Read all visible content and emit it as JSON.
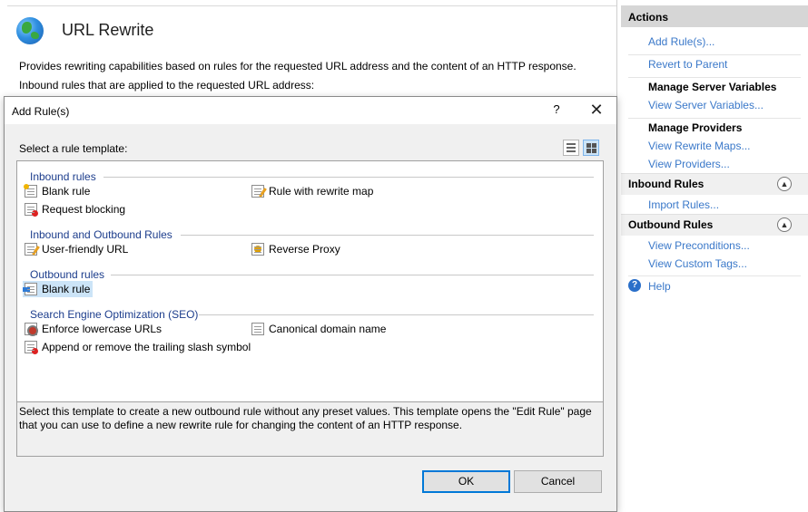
{
  "page": {
    "title": "URL Rewrite",
    "description": "Provides rewriting capabilities based on rules for the requested URL address and the content of an HTTP response.",
    "subheading": "Inbound rules that are applied to the requested URL address:"
  },
  "actions": {
    "header": "Actions",
    "add_rules": "Add Rule(s)...",
    "revert": "Revert to Parent",
    "manage_server_vars": "Manage Server Variables",
    "view_server_vars": "View Server Variables...",
    "manage_providers": "Manage Providers",
    "view_rewrite_maps": "View Rewrite Maps...",
    "view_providers": "View Providers...",
    "inbound_rules": "Inbound Rules",
    "import_rules": "Import Rules...",
    "outbound_rules": "Outbound Rules",
    "view_preconditions": "View Preconditions...",
    "view_custom_tags": "View Custom Tags...",
    "help": "Help"
  },
  "dialog": {
    "title": "Add Rule(s)",
    "help_glyph": "?",
    "close_glyph": "✕",
    "select_label": "Select a rule template:",
    "groups": {
      "inbound": "Inbound rules",
      "inout": "Inbound and Outbound Rules",
      "outbound": "Outbound rules",
      "seo": "Search Engine Optimization (SEO)"
    },
    "items": {
      "blank_rule_in": "Blank rule",
      "rule_with_map": "Rule with rewrite map",
      "request_blocking": "Request blocking",
      "user_friendly_url": "User-friendly URL",
      "reverse_proxy": "Reverse Proxy",
      "blank_rule_out": "Blank rule",
      "enforce_lowercase": "Enforce lowercase URLs",
      "canonical_domain": "Canonical domain name",
      "trailing_slash": "Append or remove the trailing slash symbol"
    },
    "selected_item": "Blank rule",
    "description": "Select this template to create a new outbound rule without any preset values. This template opens the \"Edit Rule\" page that you can use to define a new rewrite rule for changing the content of an HTTP response.",
    "ok_label": "OK",
    "cancel_label": "Cancel"
  },
  "colors": {
    "link": "#3a78c9",
    "group_header": "#1c3d8c",
    "selection": "#cce4f7",
    "default_button_border": "#0078d7"
  }
}
